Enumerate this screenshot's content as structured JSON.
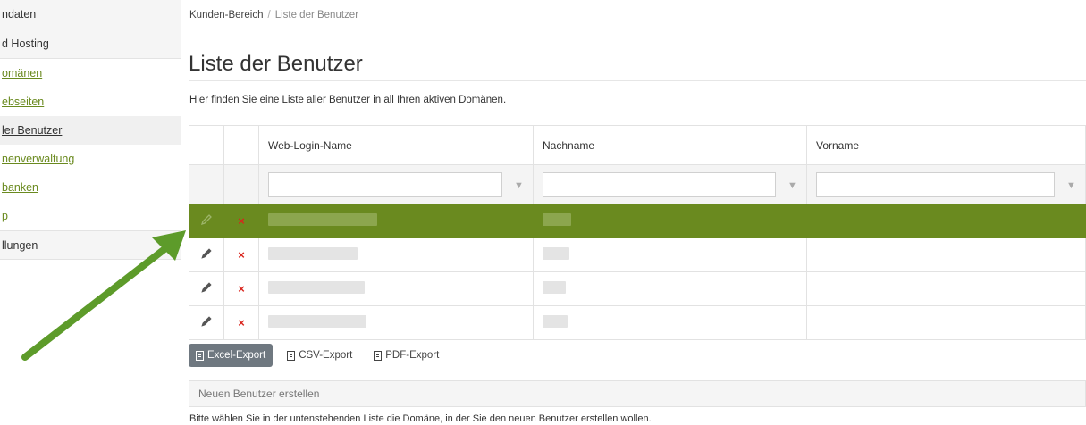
{
  "sidebar": {
    "items": [
      {
        "label": "ndaten",
        "type": "head"
      },
      {
        "label": "d Hosting",
        "type": "head"
      },
      {
        "label": "omänen",
        "type": "link"
      },
      {
        "label": "ebseiten",
        "type": "link"
      },
      {
        "label": "ler Benutzer",
        "type": "active"
      },
      {
        "label": "nenverwaltung",
        "type": "link"
      },
      {
        "label": "banken",
        "type": "link"
      },
      {
        "label": "p",
        "type": "link"
      },
      {
        "label": "llungen",
        "type": "head"
      }
    ]
  },
  "breadcrumb": {
    "root": "Kunden-Bereich",
    "separator": "/",
    "current": "Liste der Benutzer"
  },
  "page": {
    "title": "Liste der Benutzer",
    "intro": "Hier finden Sie eine Liste aller Benutzer in all Ihren aktiven Domänen."
  },
  "table": {
    "columns": [
      "Web-Login-Name",
      "Nachname",
      "Vorname"
    ],
    "rows": [
      {
        "selected": true,
        "delete_icon": "×"
      },
      {
        "selected": false,
        "delete_icon": "×"
      },
      {
        "selected": false,
        "delete_icon": "×"
      },
      {
        "selected": false,
        "delete_icon": "×"
      }
    ]
  },
  "exports": {
    "excel": "Excel-Export",
    "csv": "CSV-Export",
    "pdf": "PDF-Export"
  },
  "new_user_panel": {
    "label": "Neuen Benutzer erstellen"
  },
  "note": "Bitte wählen Sie in der untenstehenden Liste die Domäne, in der Sie den neuen Benutzer erstellen wollen.",
  "colors": {
    "accent": "#6a8a1f",
    "delete": "#d9251d",
    "arrow": "#5d9b2a",
    "button": "#6f7880"
  },
  "icons": {
    "edit": "pencil-icon",
    "delete": "delete-x-icon",
    "filter": "filter-funnel-icon",
    "export": "document-icon"
  }
}
